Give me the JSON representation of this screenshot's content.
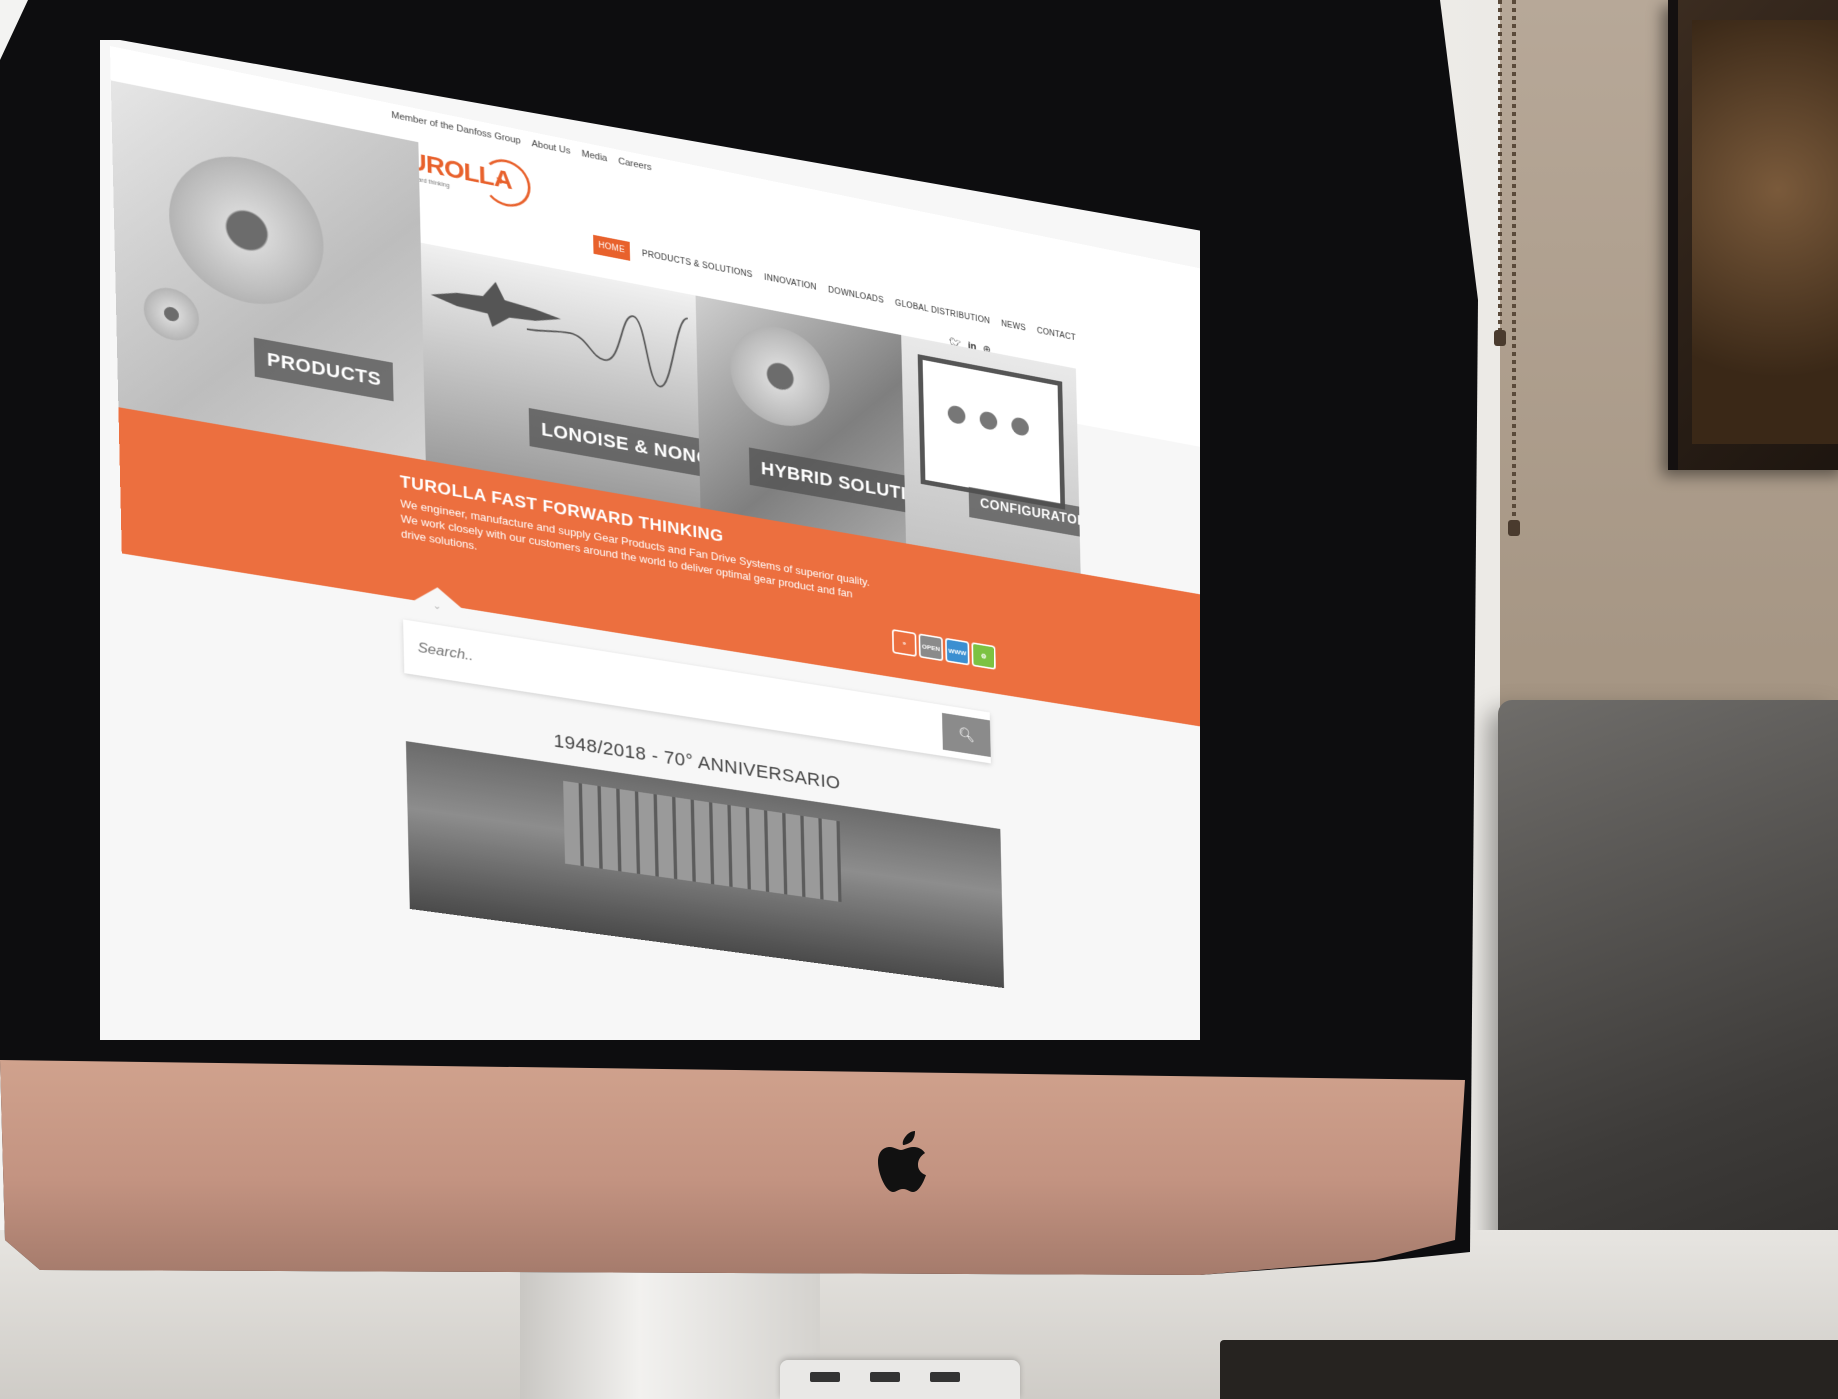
{
  "site": {
    "member_links": [
      "Member of the Danfoss Group",
      "About Us",
      "Media",
      "Careers"
    ],
    "logo_text": "TUROLLA",
    "logo_tagline": "fast forward thinking",
    "nav": [
      "HOME",
      "PRODUCTS & SOLUTIONS",
      "INNOVATION",
      "DOWNLOADS",
      "GLOBAL DISTRIBUTION",
      "NEWS",
      "CONTACT"
    ],
    "social_icons": [
      "twitter-icon",
      "linkedin-icon",
      "share-icon"
    ],
    "panels": [
      "PRODUCTS",
      "LONOISE & NONOISE",
      "HYBRID SOLUTIONS",
      "CONFIGURATOR"
    ],
    "band": {
      "title": "TUROLLA FAST FORWARD THINKING",
      "text": "We engineer, manufacture and supply Gear Products and Fan Drive Systems of superior quality. We work closely with our customers around the world to deliver optimal gear product and fan drive solutions."
    },
    "badges": [
      "»",
      "OPEN",
      "WWW",
      "⚙"
    ],
    "search_placeholder": "Search..",
    "anniversary": "1948/2018 - 70° ANNIVERSARIO"
  },
  "colors": {
    "accent": "#ec6f3f",
    "logo": "#e8612c",
    "search_button": "#8b8b8b",
    "monitor_chin": "#c39381"
  }
}
